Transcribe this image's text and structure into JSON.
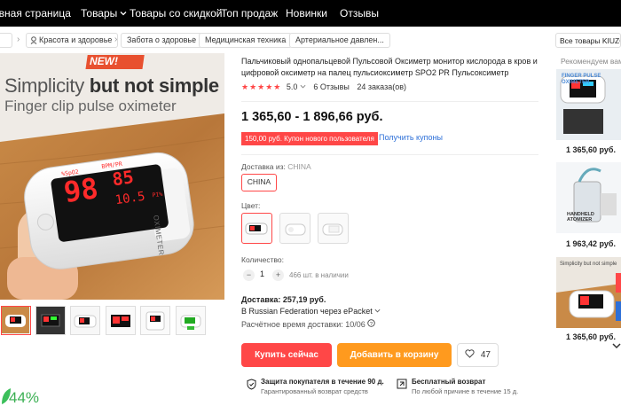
{
  "topnav": [
    "авная страница",
    "Товары",
    "Товары со скидкой",
    "Топ продаж",
    "Новинки",
    "Отзывы"
  ],
  "breadcrumbs": [
    "Красота и здоровье",
    "Забота о здоровье",
    "Медицинская техника",
    "Артериальное давлен..."
  ],
  "store_link": "Все товары KIUZOU",
  "hero": {
    "badge": "NEW!",
    "headline_a": "Simplicity ",
    "headline_b": "but not simple",
    "subline": "Finger clip pulse oximeter",
    "display_spo2": "98",
    "display_pr": "85",
    "display_pi": "10.5",
    "label_spo2": "%SpO2",
    "label_bpm": "BPM/PR",
    "label_pi": "PI%",
    "device_text": "OXIMETER"
  },
  "product": {
    "title": "Пальчиковый однопальцевой Пульсовой Оксиметр монитор кислорода в кров и цифровой оксиметр на палец пульсиоксиметр SPO2 PR Пульсоксиметр",
    "rating_value": "5.0",
    "reviews": "6 Отзывы",
    "orders": "24 заказа(ов)",
    "price": "1 365,60 - 1 896,66 руб.",
    "coupon": "150,00 руб. Купон нового пользователя",
    "coupon_link": "Получить купоны",
    "ships_from_label": "Доставка из:",
    "ships_from_value": "CHINA",
    "ships_option": "CHINA",
    "color_label": "Цвет:",
    "qty_label": "Количество:",
    "qty_value": "1",
    "stock": "466 шт. в наличии",
    "delivery": "Доставка: 257,19 руб.",
    "delivery_to": "В Russian Federation через ePacket",
    "delivery_time": "Расчётное время доставки: 10/06",
    "buy_now": "Купить сейчас",
    "add_to_cart": "Добавить в корзину",
    "wishlist_count": "47",
    "guarantee_title": "Защита покупателя в течение 90 д.",
    "guarantee_sub": "Гарантированный возврат средств",
    "return_title": "Бесплатный возврат",
    "return_sub": "По любой причине в течение 15 д."
  },
  "recommended": {
    "label": "Рекомендуем вам",
    "items": [
      {
        "price": "1 365,60 руб.",
        "caption": "FINGER PULSE OXIMETER"
      },
      {
        "price": "1 963,42 руб.",
        "caption": "HANDHELD ATOMIZER"
      },
      {
        "price": "1 365,60 руб.",
        "caption": "Simplicity but not simple"
      }
    ]
  },
  "discount_badge": "44%",
  "colors": {
    "accent": "#ff4747",
    "cart": "#ff9a1e",
    "link": "#2e70d8"
  }
}
